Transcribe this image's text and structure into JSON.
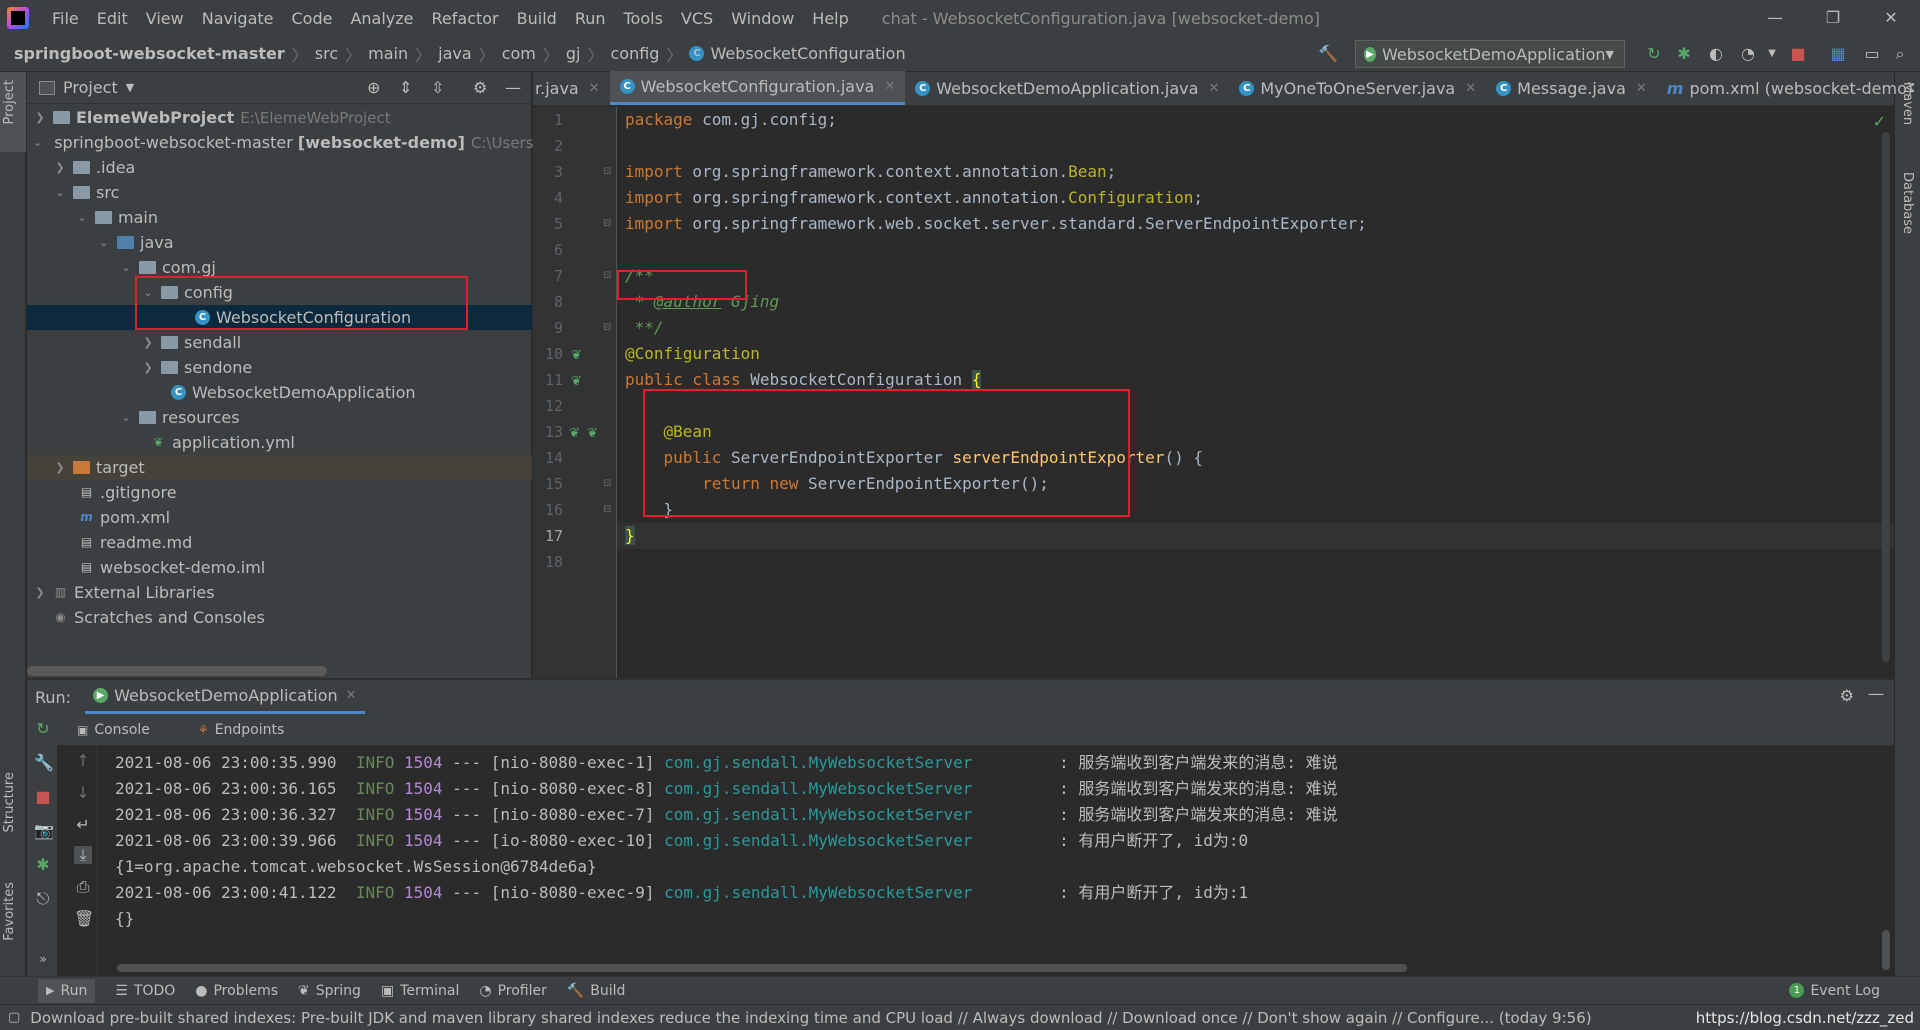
{
  "menubar": {
    "items": [
      "File",
      "Edit",
      "View",
      "Navigate",
      "Code",
      "Analyze",
      "Refactor",
      "Build",
      "Run",
      "Tools",
      "VCS",
      "Window",
      "Help"
    ],
    "window_title": "chat - WebsocketConfiguration.java [websocket-demo]",
    "min": "—",
    "max": "❐",
    "close": "✕"
  },
  "breadcrumb": [
    "springboot-websocket-master",
    "src",
    "main",
    "java",
    "com",
    "gj",
    "config",
    "WebsocketConfiguration"
  ],
  "run_config": "WebsocketDemoApplication",
  "project": {
    "title": "Project",
    "tree": [
      {
        "label": "ElemeWebProject",
        "bold": true,
        "extra": "E:\\ElemeWebProject"
      },
      {
        "label": "springboot-websocket-master",
        "bold_suffix": "[websocket-demo]",
        "extra": "C:\\Users\\"
      },
      {
        "label": ".idea"
      },
      {
        "label": "src"
      },
      {
        "label": "main"
      },
      {
        "label": "java"
      },
      {
        "label": "com.gj"
      },
      {
        "label": "config"
      },
      {
        "label": "WebsocketConfiguration"
      },
      {
        "label": "sendall"
      },
      {
        "label": "sendone"
      },
      {
        "label": "WebsocketDemoApplication"
      },
      {
        "label": "resources"
      },
      {
        "label": "application.yml"
      },
      {
        "label": "target"
      },
      {
        "label": ".gitignore"
      },
      {
        "label": "pom.xml"
      },
      {
        "label": "readme.md"
      },
      {
        "label": "websocket-demo.iml"
      },
      {
        "label": "External Libraries"
      },
      {
        "label": "Scratches and Consoles"
      }
    ]
  },
  "editor_tabs": [
    {
      "label": "r.java"
    },
    {
      "label": "WebsocketConfiguration.java",
      "active": true
    },
    {
      "label": "WebsocketDemoApplication.java"
    },
    {
      "label": "MyOneToOneServer.java"
    },
    {
      "label": "Message.java"
    },
    {
      "label": "pom.xml (websocket-demo)"
    }
  ],
  "code": {
    "line_numbers": [
      "1",
      "2",
      "3",
      "4",
      "5",
      "6",
      "7",
      "8",
      "9",
      "10",
      "11",
      "12",
      "13",
      "14",
      "15",
      "16",
      "17",
      "18"
    ]
  },
  "run": {
    "label": "Run:",
    "tab": "WebsocketDemoApplication",
    "subtabs": [
      "Console",
      "Endpoints"
    ],
    "log": [
      {
        "ts": "2021-08-06 23:00:35.990",
        "level": "INFO",
        "pid": "1504",
        "sep": "---",
        "thread": "[nio-8080-exec-1]",
        "cls": "com.gj.sendall.MyWebsocketServer",
        "msg": ": 服务端收到客户端发来的消息: 难说"
      },
      {
        "ts": "2021-08-06 23:00:36.165",
        "level": "INFO",
        "pid": "1504",
        "sep": "---",
        "thread": "[nio-8080-exec-8]",
        "cls": "com.gj.sendall.MyWebsocketServer",
        "msg": ": 服务端收到客户端发来的消息: 难说"
      },
      {
        "ts": "2021-08-06 23:00:36.327",
        "level": "INFO",
        "pid": "1504",
        "sep": "---",
        "thread": "[nio-8080-exec-7]",
        "cls": "com.gj.sendall.MyWebsocketServer",
        "msg": ": 服务端收到客户端发来的消息: 难说"
      },
      {
        "ts": "2021-08-06 23:00:39.966",
        "level": "INFO",
        "pid": "1504",
        "sep": "---",
        "thread": "[io-8080-exec-10]",
        "cls": "com.gj.sendall.MyWebsocketServer",
        "msg": ": 有用户断开了, id为:0"
      },
      {
        "plain": "{1=org.apache.tomcat.websocket.WsSession@6784de6a}"
      },
      {
        "ts": "2021-08-06 23:00:41.122",
        "level": "INFO",
        "pid": "1504",
        "sep": "---",
        "thread": "[nio-8080-exec-9]",
        "cls": "com.gj.sendall.MyWebsocketServer",
        "msg": ": 有用户断开了, id为:1"
      },
      {
        "plain": "{}"
      }
    ]
  },
  "bottom_tabs": [
    "Run",
    "TODO",
    "Problems",
    "Spring",
    "Terminal",
    "Profiler",
    "Build"
  ],
  "event_log": "Event Log",
  "event_count": "1",
  "status": "Download pre-built shared indexes: Pre-built JDK and maven library shared indexes reduce the indexing time and CPU load // Always download // Download once // Don't show again // Configure... (today 9:56)",
  "watermark": "https://blog.csdn.net/zzz_zed",
  "side_tabs": {
    "project": "Project",
    "structure": "Structure",
    "favorites": "Favorites",
    "maven": "Maven",
    "database": "Database"
  },
  "colors": {
    "bg": "#2b2b2b",
    "panel": "#3c3f41",
    "accent": "#4a88c7",
    "highlight_box": "#e0202d"
  }
}
